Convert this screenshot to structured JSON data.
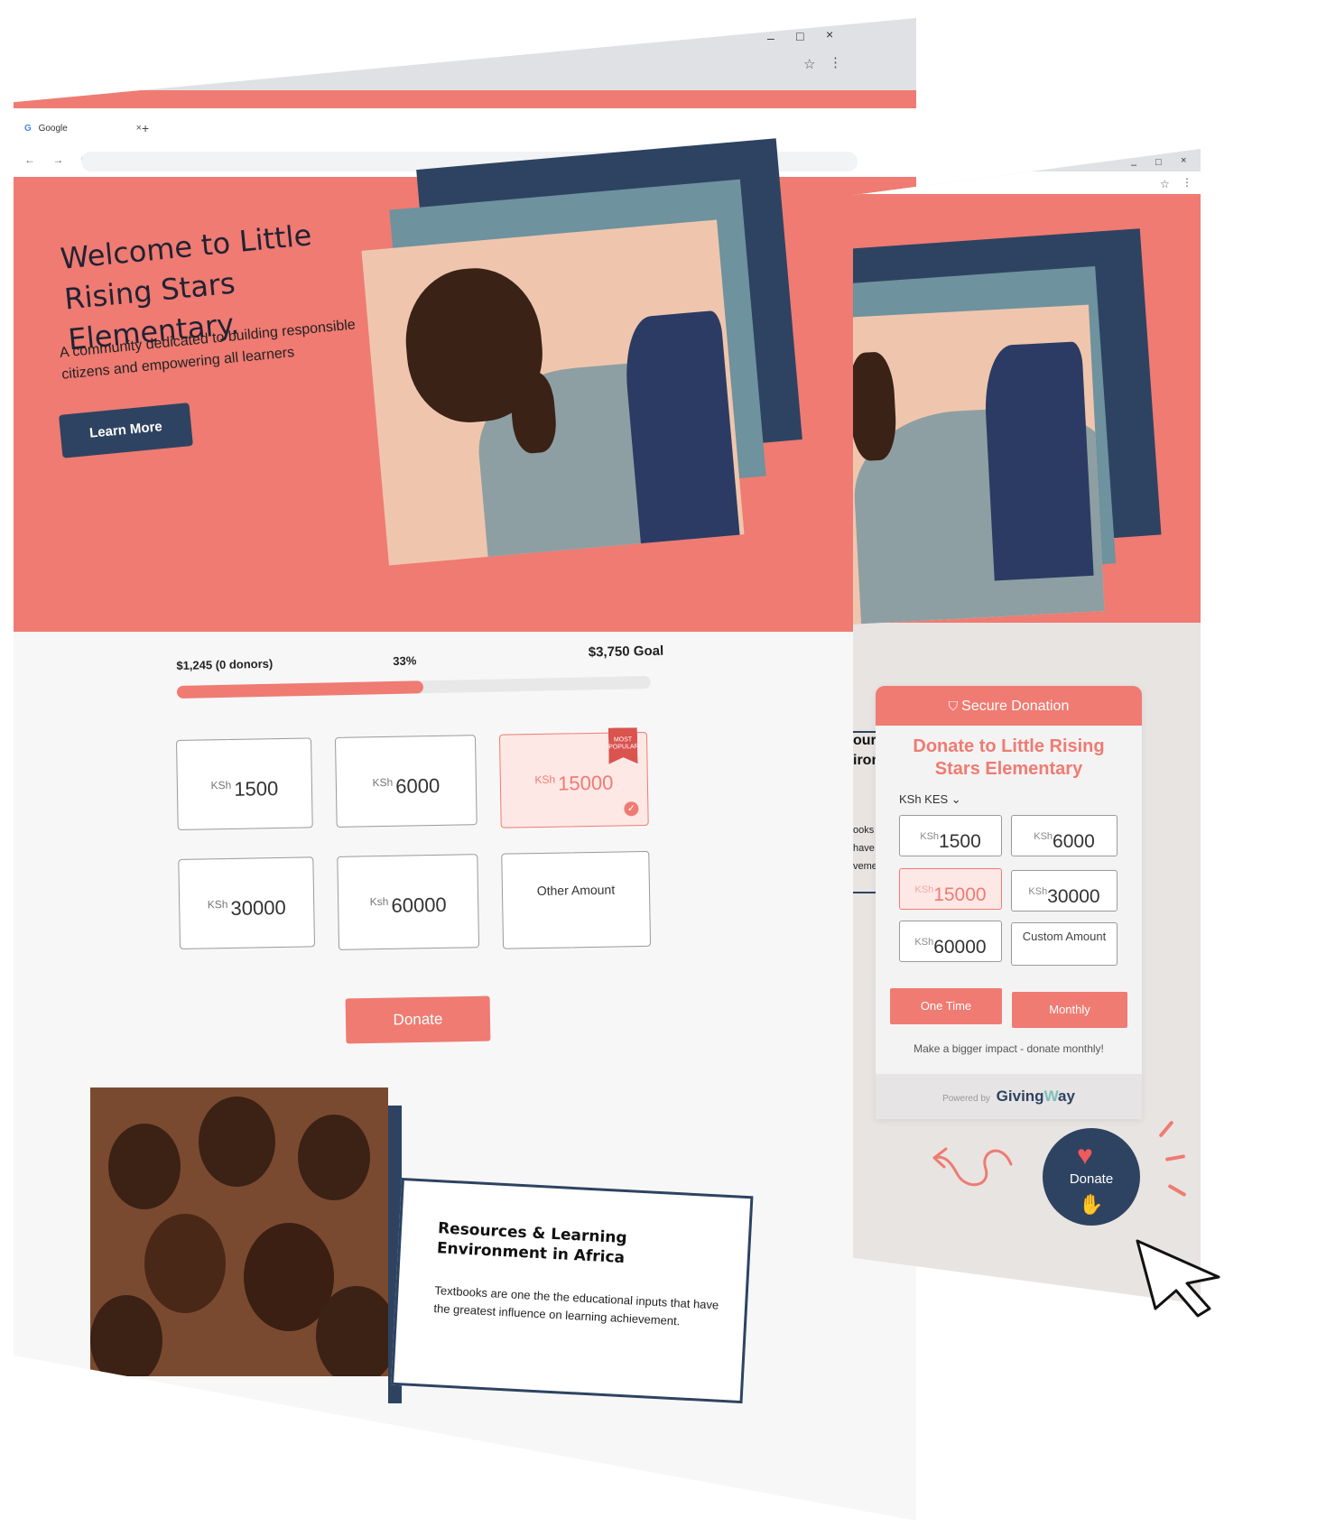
{
  "window1": {
    "tab_label": "Google",
    "tab_g": "G",
    "tab_close": "×",
    "new_tab": "+",
    "nav": "← → C",
    "controls": {
      "minimize": "–",
      "maximize": "□",
      "close": "×"
    },
    "star": "☆",
    "menu": "⋮",
    "hero": {
      "title": "Welcome to Little Rising Stars Elementary.",
      "subtitle": "A community dedicated to building responsible citizens and empowering all learners",
      "cta": "Learn More"
    },
    "progress": {
      "raised": "$1,245 (0 donors)",
      "percent_label": "33%",
      "goal": "$3,750 Goal",
      "fill_fraction": 0.52
    },
    "currency": "KSh",
    "currency_alt": "Ksh",
    "amounts": [
      "1500",
      "6000",
      "15000",
      "30000",
      "60000"
    ],
    "other_amount": "Other Amount",
    "badge": "MOST POPULAR",
    "check": "✓",
    "donate_button": "Donate",
    "resources": {
      "title": "Resources & Learning Environment in Africa",
      "text": "Textbooks are one the the educational inputs that have the greatest influence on learning achievement."
    }
  },
  "window2": {
    "controls": {
      "minimize": "–",
      "maximize": "□",
      "close": "×"
    },
    "star": "☆",
    "menu": "⋮",
    "peek_heading": "our iron",
    "peek_text": "ooks have t veme",
    "widget": {
      "header": "Secure Donation",
      "shield": "⛉",
      "title": "Donate to Little Rising Stars Elementary",
      "currency_select": "KSh KES ⌄",
      "currency": "KSh",
      "amounts": [
        "1500",
        "6000",
        "15000",
        "30000",
        "60000"
      ],
      "custom_amount": "Custom Amount",
      "one_time": "One Time",
      "monthly": "Monthly",
      "hint": "Make a bigger impact - donate monthly!",
      "powered_by": "Powered by",
      "brand_a": "Giving",
      "brand_w": "W",
      "brand_b": "ay"
    },
    "fab": {
      "label": "Donate",
      "heart": "♥",
      "hand": "✋"
    }
  },
  "colors": {
    "coral": "#ef7b72",
    "navy": "#2e4361",
    "teal": "#6e929e"
  }
}
